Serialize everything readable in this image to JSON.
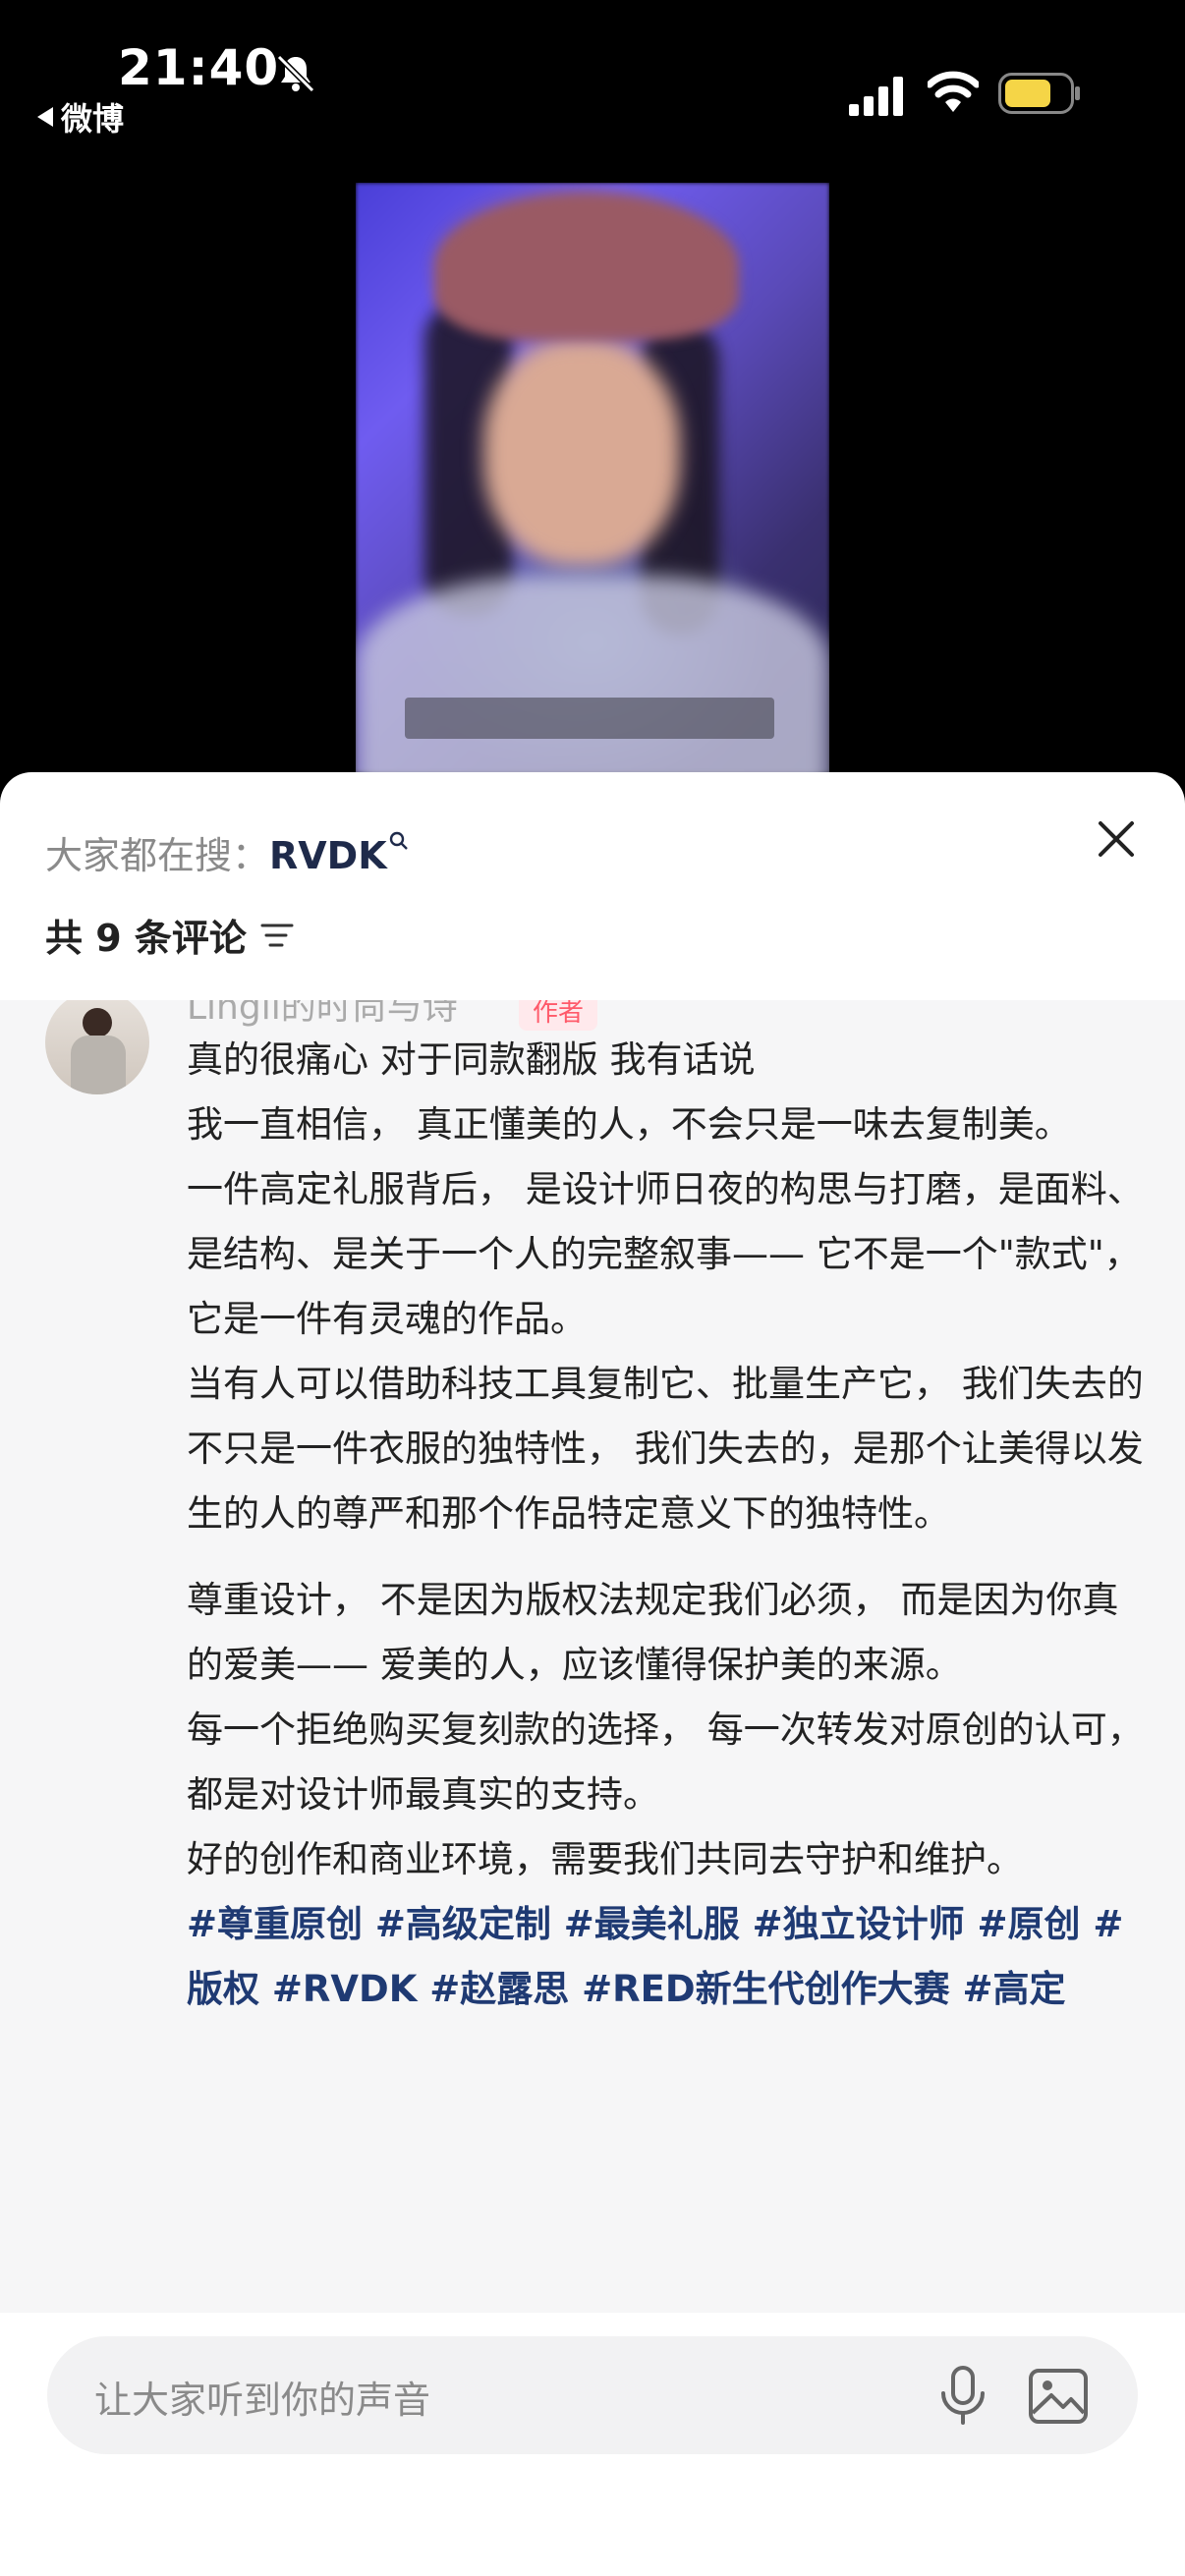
{
  "status_bar": {
    "time": "21:40",
    "back_app": "微博",
    "battery_color": "#f5d547"
  },
  "video": {
    "icons": [
      "video-thumbnail"
    ]
  },
  "sheet": {
    "trending_prefix": "大家都在搜：",
    "trending_keyword": "RVDK",
    "comment_count": "共 9 条评论",
    "comment": {
      "author_name": "Lingli的时尚与诗",
      "author_tag": "作者",
      "paragraphs": [
        "真的很痛心 对于同款翻版 我有话说",
        "我一直相信， 真正懂美的人，不会只是一味去复制美。",
        "一件高定礼服背后， 是设计师日夜的构思与打磨，是面料、是结构、是关于一个人的完整叙事—— 它不是一个\"款式\"， 它是一件有灵魂的作品。",
        "当有人可以借助科技工具复制它、批量生产它， 我们失去的不只是一件衣服的独特性， 我们失去的，是那个让美得以发生的人的尊严和那个作品特定意义下的独特性。",
        "尊重设计， 不是因为版权法规定我们必须， 而是因为你真的爱美—— 爱美的人，应该懂得保护美的来源。",
        "每一个拒绝购买复刻款的选择， 每一次转发对原创的认可， 都是对设计师最真实的支持。",
        "好的创作和商业环境，需要我们共同去守护和维护。"
      ],
      "hashtags": "#尊重原创 #高级定制 #最美礼服 #独立设计师 #原创 #版权 #RVDK #赵露思 #RED新生代创作大赛 #高定"
    },
    "input": {
      "placeholder": "让大家听到你的声音"
    }
  }
}
